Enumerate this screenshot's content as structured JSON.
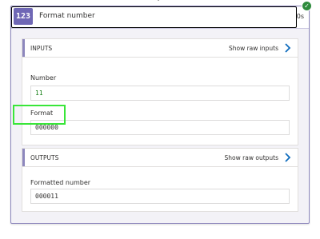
{
  "action": {
    "icon_text": "123",
    "title": "Format number",
    "duration": "0s",
    "status": "succeeded"
  },
  "inputs": {
    "section_title": "INPUTS",
    "raw_link": "Show raw inputs",
    "fields": [
      {
        "label": "Number",
        "value": "11"
      },
      {
        "label": "Format",
        "value": "000000"
      }
    ]
  },
  "outputs": {
    "section_title": "OUTPUTS",
    "raw_link": "Show raw outputs",
    "fields": [
      {
        "label": "Formatted number",
        "value": "000011"
      }
    ]
  },
  "colors": {
    "accent": "#6f67b5",
    "number_value": "#107c10",
    "highlight": "#39e639",
    "success": "#2e8b3d"
  }
}
